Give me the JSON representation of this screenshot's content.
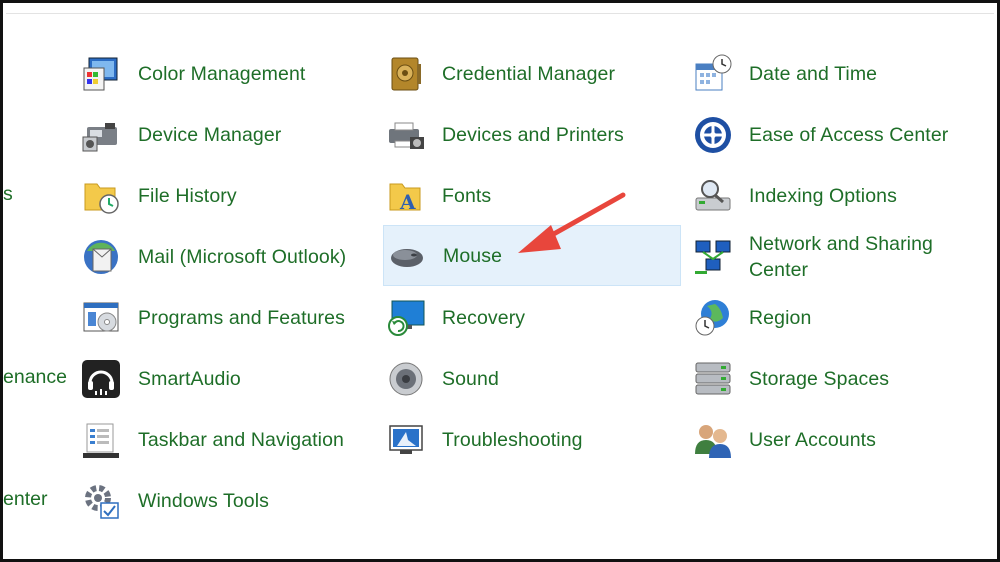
{
  "left_partial": [
    "s",
    "enance",
    "enter"
  ],
  "columns": [
    [
      {
        "label": "Color Management",
        "icon": "color-management-icon"
      },
      {
        "label": "Device Manager",
        "icon": "device-manager-icon"
      },
      {
        "label": "File History",
        "icon": "file-history-icon"
      },
      {
        "label": "Mail (Microsoft Outlook)",
        "icon": "mail-icon"
      },
      {
        "label": "Programs and Features",
        "icon": "programs-features-icon"
      },
      {
        "label": "SmartAudio",
        "icon": "smartaudio-icon"
      },
      {
        "label": "Taskbar and Navigation",
        "icon": "taskbar-icon"
      },
      {
        "label": "Windows Tools",
        "icon": "windows-tools-icon"
      }
    ],
    [
      {
        "label": "Credential Manager",
        "icon": "credential-manager-icon"
      },
      {
        "label": "Devices and Printers",
        "icon": "printer-icon"
      },
      {
        "label": "Fonts",
        "icon": "fonts-icon"
      },
      {
        "label": "Mouse",
        "icon": "mouse-icon",
        "selected": true
      },
      {
        "label": "Recovery",
        "icon": "recovery-icon"
      },
      {
        "label": "Sound",
        "icon": "speaker-icon"
      },
      {
        "label": "Troubleshooting",
        "icon": "troubleshooting-icon"
      }
    ],
    [
      {
        "label": "Date and Time",
        "icon": "calendar-clock-icon"
      },
      {
        "label": "Ease of Access Center",
        "icon": "ease-of-access-icon"
      },
      {
        "label": "Indexing Options",
        "icon": "indexing-icon"
      },
      {
        "label": "Network and Sharing Center",
        "icon": "network-icon"
      },
      {
        "label": "Region",
        "icon": "globe-clock-icon"
      },
      {
        "label": "Storage Spaces",
        "icon": "storage-icon"
      },
      {
        "label": "User Accounts",
        "icon": "users-icon"
      }
    ]
  ],
  "colors": {
    "link": "#1e6e28",
    "selected_bg": "#e5f1fb",
    "arrow": "#e8463c"
  }
}
